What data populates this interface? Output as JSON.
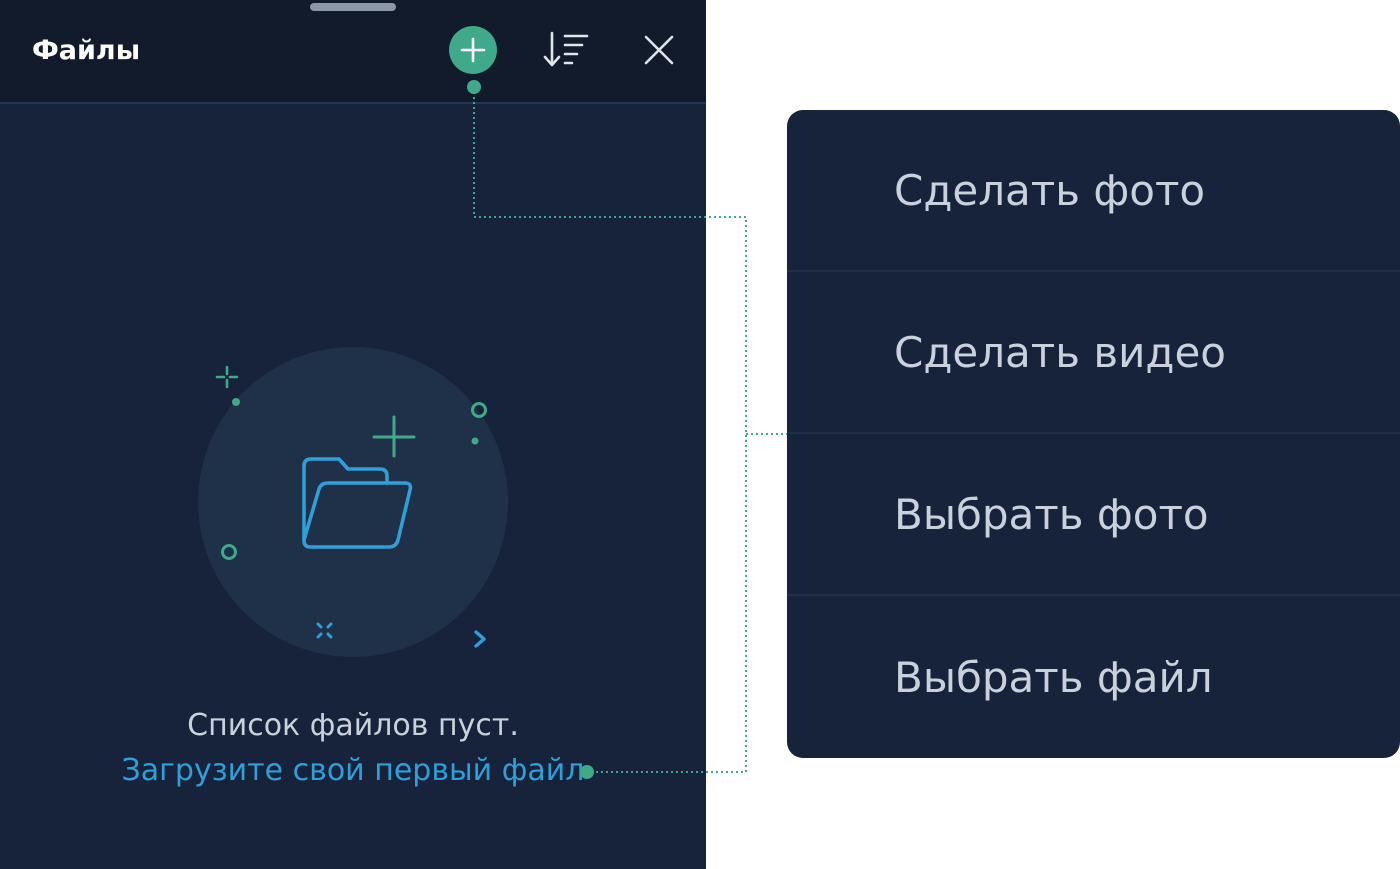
{
  "header": {
    "title": "Файлы"
  },
  "icons": {
    "add": "plus-circle-icon",
    "sort": "sort-descending-icon",
    "close": "close-icon",
    "empty_state": "folder-add-icon"
  },
  "empty_state": {
    "message": "Список файлов пуст.",
    "upload_link": "Загрузите свой первый файл"
  },
  "menu": {
    "items": [
      {
        "label": "Сделать фото"
      },
      {
        "label": "Сделать видео"
      },
      {
        "label": "Выбрать фото"
      },
      {
        "label": "Выбрать файл"
      }
    ]
  },
  "colors": {
    "accent": "#3fa98a",
    "link": "#2e9fd8",
    "panel_bg": "#16233a",
    "header_bg": "#111b2b",
    "text": "#c9d1dc"
  }
}
